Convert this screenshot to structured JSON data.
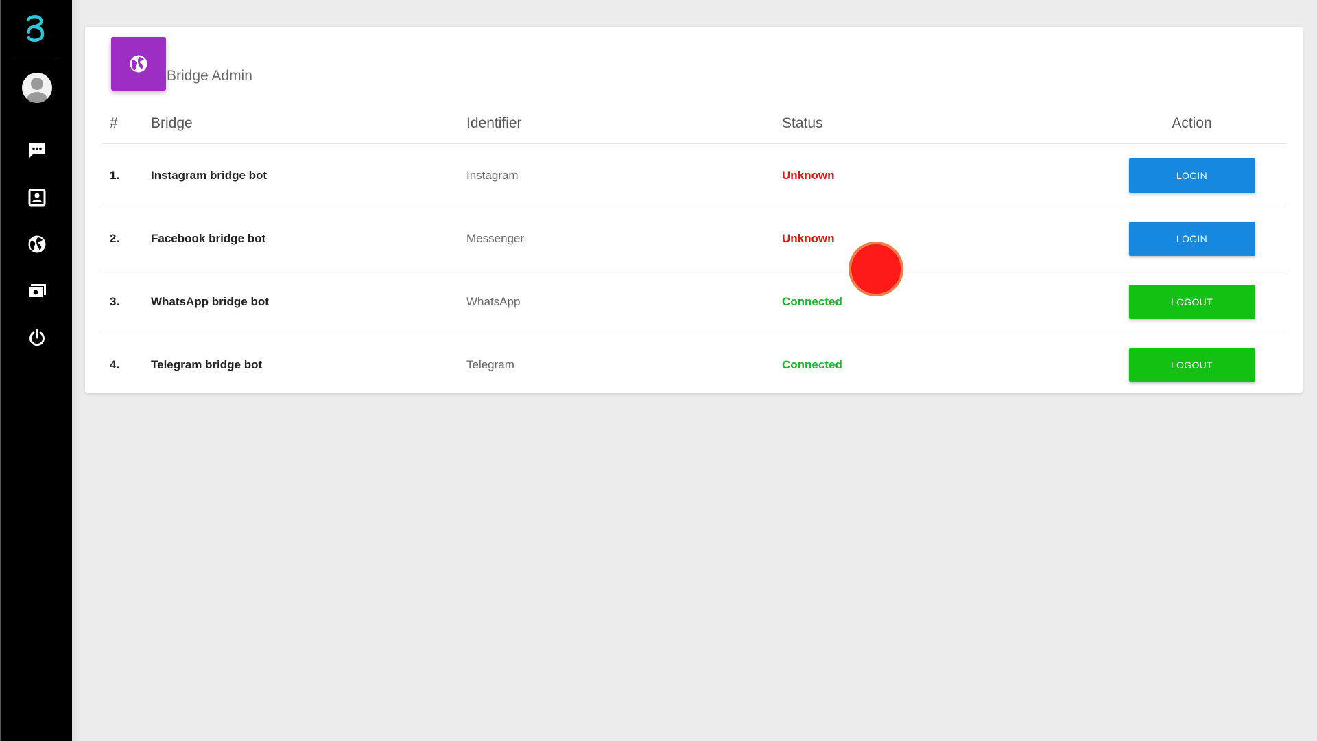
{
  "app": {
    "logo_icon": "bridge-logo-icon",
    "accent_color": "#9c2ec4"
  },
  "sidebar": {
    "items": [
      {
        "name": "chat",
        "icon": "chat-icon"
      },
      {
        "name": "contacts",
        "icon": "contact-card-icon"
      },
      {
        "name": "bridges",
        "icon": "globe-icon"
      },
      {
        "name": "media",
        "icon": "media-icon"
      },
      {
        "name": "logout",
        "icon": "power-icon"
      }
    ]
  },
  "card": {
    "title": "Bridge Admin",
    "icon": "globe-icon"
  },
  "table": {
    "headers": {
      "num": "#",
      "bridge": "Bridge",
      "identifier": "Identifier",
      "status": "Status",
      "action": "Action"
    },
    "rows": [
      {
        "num": "1.",
        "bridge": "Instagram bridge bot",
        "identifier": "Instagram",
        "status": "Unknown",
        "action": "LOGIN"
      },
      {
        "num": "2.",
        "bridge": "Facebook bridge bot",
        "identifier": "Messenger",
        "status": "Unknown",
        "action": "LOGIN"
      },
      {
        "num": "3.",
        "bridge": "WhatsApp bridge bot",
        "identifier": "WhatsApp",
        "status": "Connected",
        "action": "LOGOUT"
      },
      {
        "num": "4.",
        "bridge": "Telegram bridge bot",
        "identifier": "Telegram",
        "status": "Connected",
        "action": "LOGOUT"
      }
    ]
  },
  "colors": {
    "status_unknown": "#ee1111",
    "status_connected": "#1bb52a",
    "login_button": "#1688e0",
    "logout_button": "#12c112"
  }
}
